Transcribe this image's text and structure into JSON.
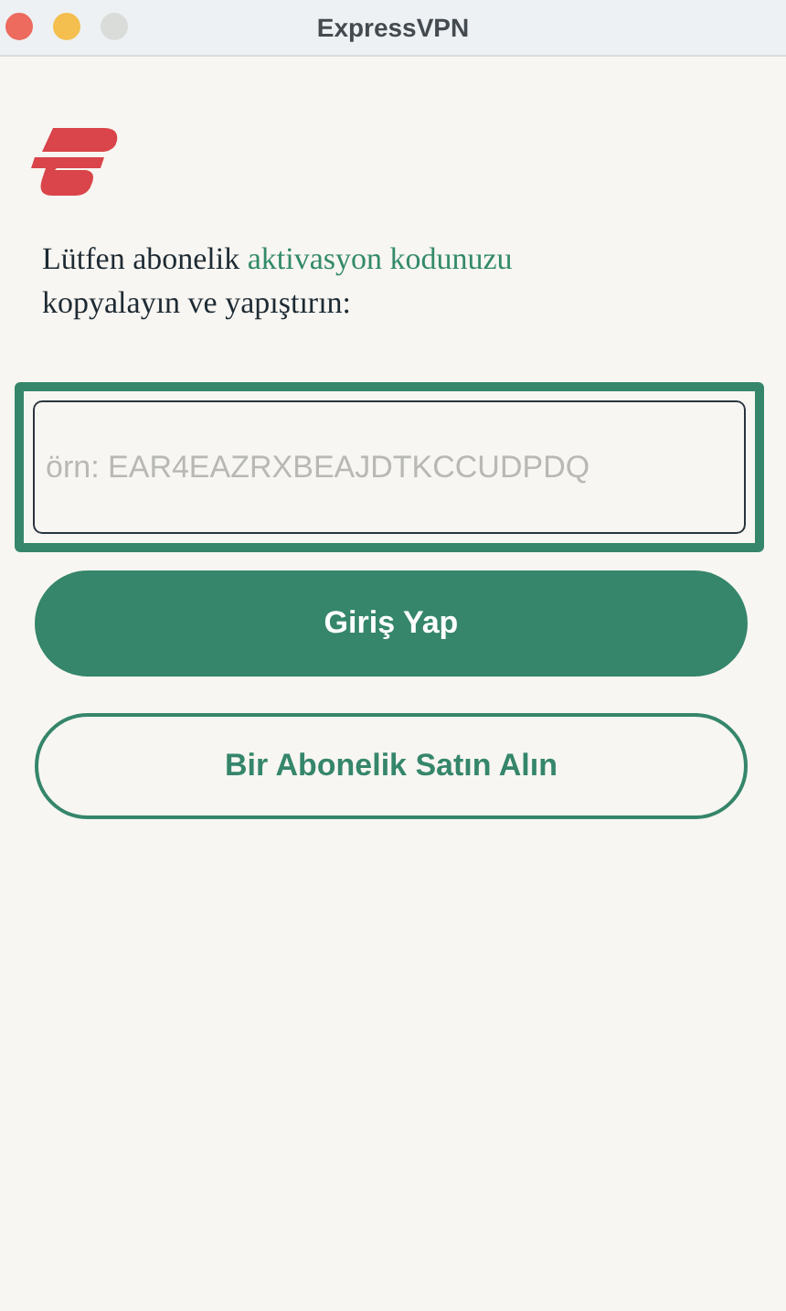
{
  "window": {
    "title": "ExpressVPN",
    "traffic_lights": [
      {
        "color": "#ec6a5e"
      },
      {
        "color": "#f4bf4f"
      },
      {
        "color": "#d9dcd9"
      }
    ]
  },
  "instruction": {
    "before": "Lütfen abonelik",
    "link": "aktivasyon kodunuzu",
    "after": "kopyalayın ve yapıştırın:"
  },
  "code_field": {
    "placeholder": "örn: EAR4EAZRXBEAJDTKCCUDPDQ",
    "focused": true
  },
  "buttons": [
    {
      "label": "Giriş Yap",
      "kind": "primary"
    },
    {
      "label": "Bir Abonelik Satın Alın",
      "kind": "secondary"
    }
  ]
}
